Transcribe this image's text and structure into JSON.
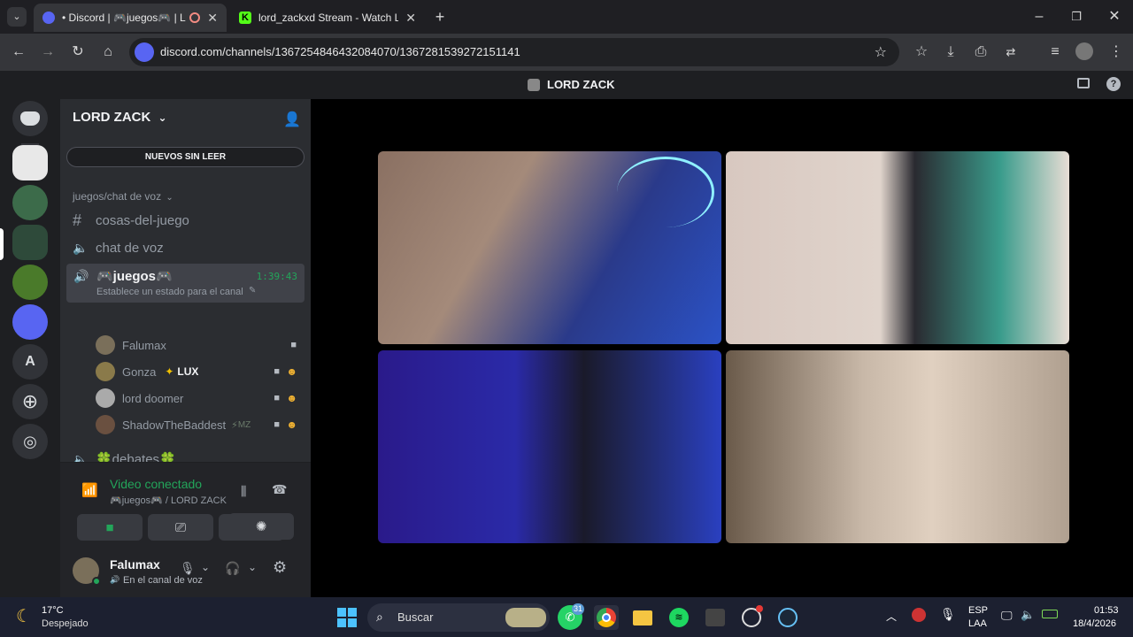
{
  "browser": {
    "tabs": [
      {
        "title": "• Discord | 🎮juegos🎮 | LC",
        "active": true
      },
      {
        "title": "lord_zackxd Stream - Watch Liv",
        "active": false
      }
    ],
    "new_tab": "+",
    "url": "discord.com/channels/1367254846432084070/1367281539272151141"
  },
  "discord": {
    "window_title": "LORD ZACK",
    "server_name": "LORD ZACK",
    "unread_button": "NUEVOS SIN LEER",
    "guild_letter": "A",
    "category": "juegos/chat de voz",
    "channels": [
      {
        "name": "cosas-del-juego",
        "icon": "hash-icon"
      },
      {
        "name": "chat de voz",
        "icon": "speaker-icon"
      }
    ],
    "active_voice": {
      "name": "🎮juegos🎮",
      "timer": "1:39:43",
      "status": "Establece un estado para el canal"
    },
    "members": [
      {
        "name": "Falumax",
        "badge": ""
      },
      {
        "name": "Gonza",
        "badge": "LUX"
      },
      {
        "name": "lord doomer",
        "badge": ""
      },
      {
        "name": "ShadowTheBaddest",
        "badge": "MZ"
      }
    ],
    "other_voice": "🍀debates🍀",
    "voice_panel": {
      "status": "Video conectado",
      "location": "🎮juegos🎮 / LORD ZACK"
    },
    "user": {
      "name": "Falumax",
      "status": "En el canal de voz"
    }
  },
  "taskbar": {
    "weather_temp": "17°C",
    "weather_desc": "Despejado",
    "search_placeholder": "Buscar",
    "whatsapp_badge": "31",
    "lang_top": "ESP",
    "lang_bottom": "LAA",
    "time": "01:53",
    "date": "18/4/2026"
  },
  "colors": {
    "discord_blurple": "#5865f2",
    "voice_green": "#23a55a",
    "sidebar": "#2b2d31",
    "taskbar": "#1c2030"
  }
}
